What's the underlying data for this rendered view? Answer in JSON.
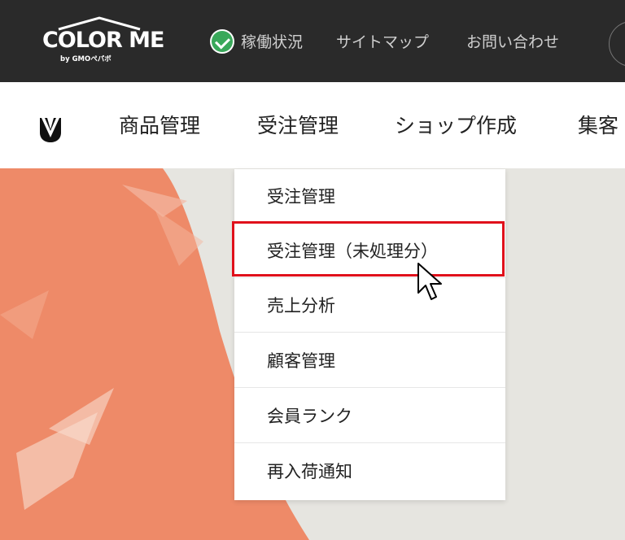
{
  "header": {
    "logo_text": "COLOR ME",
    "logo_sub": "by GMOペパボ",
    "status_label": "稼働状況",
    "sitemap_label": "サイトマップ",
    "contact_label": "お問い合わせ"
  },
  "nav": {
    "items": [
      {
        "label": "商品管理"
      },
      {
        "label": "受注管理"
      },
      {
        "label": "ショップ作成"
      },
      {
        "label": "集客"
      }
    ]
  },
  "dropdown": {
    "items": [
      {
        "label": "受注管理"
      },
      {
        "label": "受注管理（未処理分）"
      },
      {
        "label": "売上分析"
      },
      {
        "label": "顧客管理"
      },
      {
        "label": "会員ランク"
      },
      {
        "label": "再入荷通知"
      }
    ],
    "highlighted_index": 1
  },
  "colors": {
    "header_bg": "#2a2a2a",
    "status_ok": "#39a85a",
    "highlight": "#e0101b",
    "hero_orange": "#ee8a68"
  },
  "icons": [
    "check-circle-icon",
    "brand-icon",
    "mouse-pointer-icon"
  ]
}
